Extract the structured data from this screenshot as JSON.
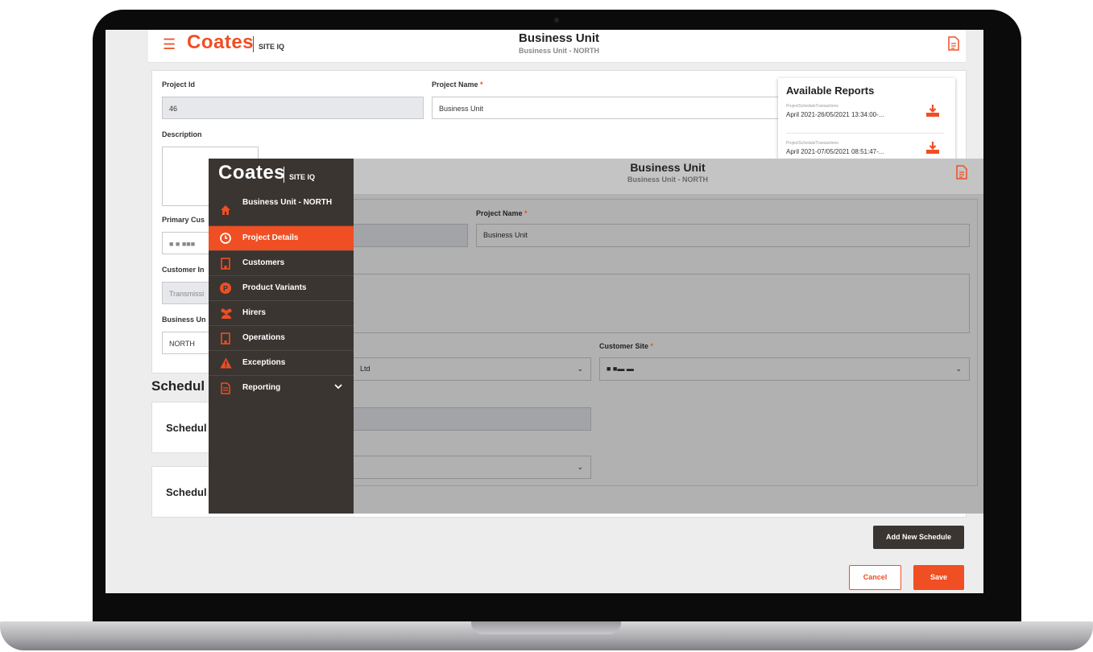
{
  "colors": {
    "brand": "#f04e23",
    "sidebar": "#3a3531"
  },
  "background": {
    "header": {
      "brand": "Coates",
      "brand_suffix": "SITE IQ",
      "title": "Business Unit",
      "subtitle": "Business Unit - NORTH",
      "report_icon": "document-icon",
      "menu_icon": "hamburger-menu-icon"
    },
    "form": {
      "project_id_label": "Project Id",
      "project_id_value": "46",
      "project_name_label": "Project Name",
      "project_name_required": "*",
      "project_name_value": "Business Unit",
      "description_label": "Description",
      "primary_customer_label": "Primary Cus",
      "primary_customer_value": "■ ■ ■■■",
      "customer_in_label": "Customer In",
      "customer_in_value": "Transmissi",
      "business_unit_label": "Business Un",
      "business_unit_value": "NORTH"
    },
    "schedules_heading": "Schedul",
    "schedule_cards": [
      {
        "label": "Schedul"
      },
      {
        "label": "Schedul"
      }
    ],
    "buttons": {
      "add_schedule": "Add New Schedule",
      "cancel": "Cancel",
      "save": "Save"
    },
    "reports": {
      "title": "Available Reports",
      "items": [
        {
          "name": "ProjectScheduleTransactions",
          "date": "April 2021-26/05/2021 13:34:00-..."
        },
        {
          "name": "ProjectScheduleTransactions",
          "date": "April 2021-07/05/2021 08:51:47-..."
        }
      ]
    }
  },
  "overlay": {
    "header": {
      "brand": "Coates",
      "brand_suffix": "SITE IQ",
      "title": "Business Unit",
      "subtitle": "Business Unit - NORTH",
      "report_icon": "document-icon"
    },
    "sidebar": {
      "items": [
        {
          "label": "Business Unit - NORTH",
          "icon": "home-icon",
          "active": false
        },
        {
          "label": "Project Details",
          "icon": "clock-icon",
          "active": true
        },
        {
          "label": "Customers",
          "icon": "building-icon",
          "active": false
        },
        {
          "label": "Product Variants",
          "icon": "p-circle-icon",
          "active": false
        },
        {
          "label": "Hirers",
          "icon": "users-icon",
          "active": false
        },
        {
          "label": "Operations",
          "icon": "building-icon",
          "active": false
        },
        {
          "label": "Exceptions",
          "icon": "warning-icon",
          "active": false
        },
        {
          "label": "Reporting",
          "icon": "report-icon",
          "active": false,
          "expandable": true
        }
      ]
    },
    "form": {
      "project_name_label": "Project Name",
      "project_name_required": "*",
      "project_name_value": "Business Unit",
      "customer_value": "Ltd",
      "customer_site_label": "Customer Site",
      "customer_site_required": "*",
      "customer_site_value": "■  ■▬ ▬"
    }
  }
}
